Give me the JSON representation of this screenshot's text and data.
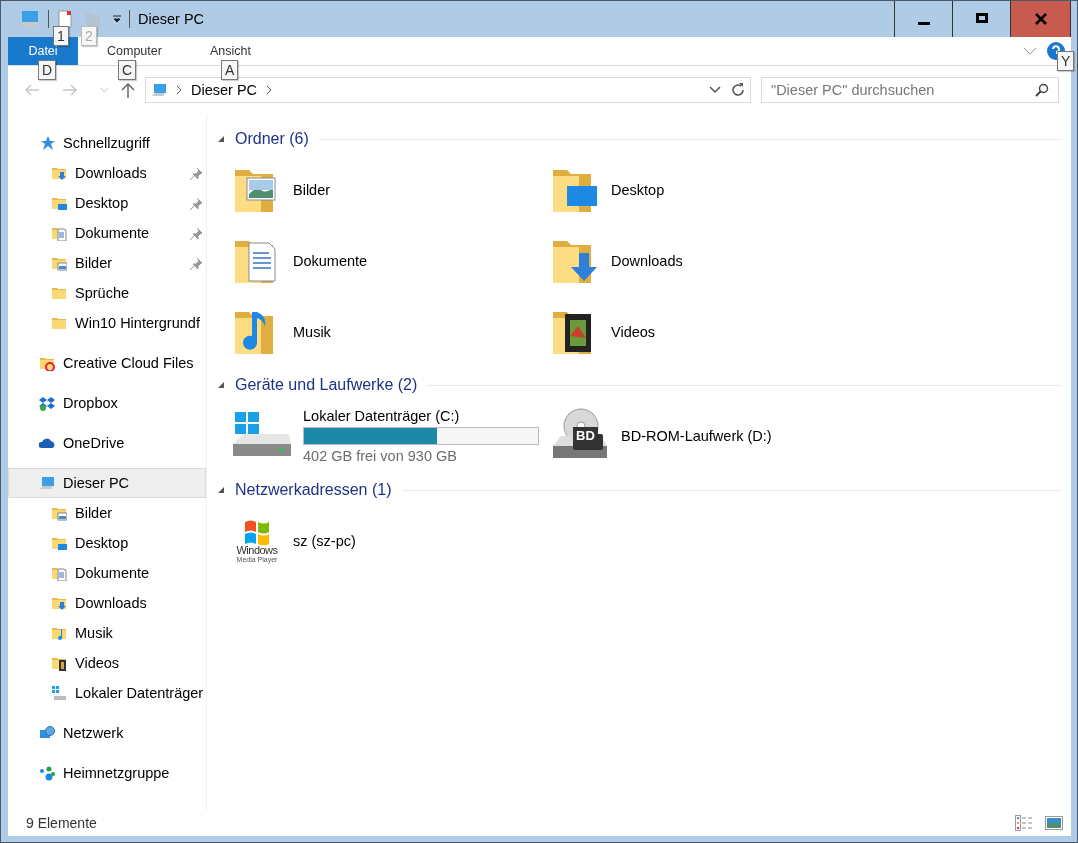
{
  "titlebar": {
    "title": "Dieser PC",
    "keytips": [
      "1",
      "2"
    ]
  },
  "ribbon": {
    "tabs": [
      {
        "label": "Datei",
        "kind": "file",
        "keytip": "D"
      },
      {
        "label": "Computer",
        "kind": "tab",
        "keytip": "C"
      },
      {
        "label": "Ansicht",
        "kind": "tab",
        "keytip": "A"
      }
    ],
    "help_keytip": "Y"
  },
  "navigation": {
    "path": [
      "Dieser PC"
    ],
    "search": {
      "placeholder": "\"Dieser PC\" durchsuchen"
    }
  },
  "sidebar": {
    "items": [
      {
        "label": "Schnellzugriff",
        "kind": "star",
        "selected": false,
        "children": [
          {
            "label": "Downloads",
            "kind": "downloads",
            "pinned": true,
            "selected": false
          },
          {
            "label": "Desktop",
            "kind": "desktop",
            "pinned": true,
            "selected": false
          },
          {
            "label": "Dokumente",
            "kind": "documents",
            "pinned": true,
            "selected": false
          },
          {
            "label": "Bilder",
            "kind": "pictures",
            "pinned": true,
            "selected": false
          },
          {
            "label": "Sprüche",
            "kind": "folder",
            "pinned": false,
            "selected": false
          },
          {
            "label": "Win10 Hintergrundf",
            "kind": "folder",
            "pinned": false,
            "selected": false
          }
        ]
      },
      {
        "label": "Creative Cloud Files",
        "kind": "creative",
        "selected": false
      },
      {
        "label": "Dropbox",
        "kind": "dropbox",
        "selected": false
      },
      {
        "label": "OneDrive",
        "kind": "onedrive",
        "selected": false
      },
      {
        "label": "Dieser PC",
        "kind": "pc",
        "selected": true,
        "children": [
          {
            "label": "Bilder",
            "kind": "pictures",
            "pinned": false,
            "selected": false
          },
          {
            "label": "Desktop",
            "kind": "desktop",
            "pinned": false,
            "selected": false
          },
          {
            "label": "Dokumente",
            "kind": "documents",
            "pinned": false,
            "selected": false
          },
          {
            "label": "Downloads",
            "kind": "downloads",
            "pinned": false,
            "selected": false
          },
          {
            "label": "Musik",
            "kind": "music",
            "pinned": false,
            "selected": false
          },
          {
            "label": "Videos",
            "kind": "videos",
            "pinned": false,
            "selected": false
          },
          {
            "label": "Lokaler Datenträger",
            "kind": "drive",
            "pinned": false,
            "selected": false
          }
        ]
      },
      {
        "label": "Netzwerk",
        "kind": "network",
        "selected": false
      },
      {
        "label": "Heimnetzgruppe",
        "kind": "homegroup",
        "selected": false
      }
    ]
  },
  "sections": [
    {
      "title": "Ordner (6)",
      "expanded": true,
      "items": [
        {
          "name": "Bilder",
          "kind": "pictures"
        },
        {
          "name": "Desktop",
          "kind": "desktop"
        },
        {
          "name": "Dokumente",
          "kind": "documents"
        },
        {
          "name": "Downloads",
          "kind": "downloads"
        },
        {
          "name": "Musik",
          "kind": "music"
        },
        {
          "name": "Videos",
          "kind": "videos"
        }
      ]
    },
    {
      "title": "Geräte und Laufwerke (2)",
      "expanded": true,
      "items": [
        {
          "name": "Lokaler Datenträger (C:)",
          "kind": "disk",
          "level": 0.57,
          "free": "402 GB frei von 930 GB"
        },
        {
          "name": "BD-ROM-Laufwerk (D:)",
          "kind": "optical",
          "badge": "BD"
        }
      ]
    },
    {
      "title": "Netzwerkadressen (1)",
      "expanded": true,
      "items": [
        {
          "name": "sz (sz-pc)",
          "kind": "media",
          "logo": [
            "Windows",
            "Media Player"
          ]
        }
      ]
    }
  ],
  "status_bar": {
    "text": "9 Elemente"
  }
}
